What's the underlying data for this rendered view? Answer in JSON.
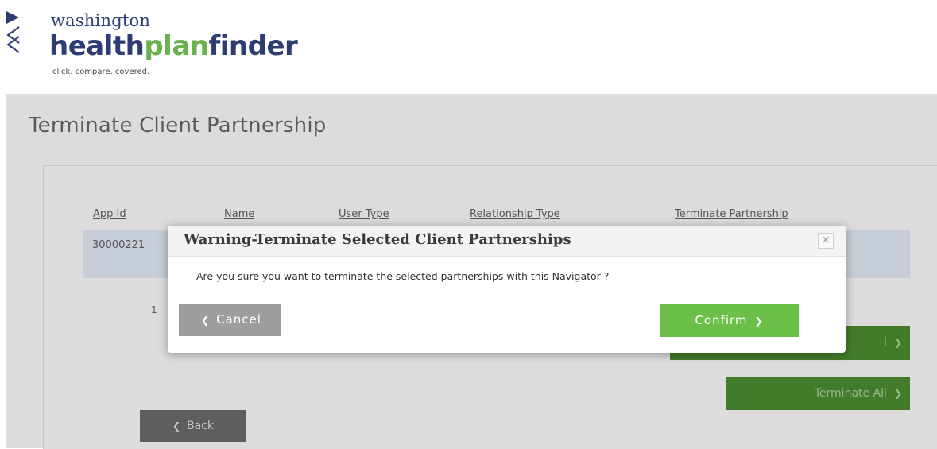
{
  "header": {
    "logo_word1": "washington",
    "logo_health": "health",
    "logo_plan": "plan",
    "logo_finder": "finder",
    "tagline": "click. compare. covered."
  },
  "page": {
    "title": "Terminate Client Partnership"
  },
  "table": {
    "columns": [
      "App Id",
      "Name",
      "User Type",
      "Relationship Type",
      "Terminate Partnership"
    ],
    "rows": [
      {
        "app_id": "30000221"
      }
    ]
  },
  "pagination": {
    "current_page": "1"
  },
  "buttons": {
    "terminate_selected_visible": "l",
    "terminate_all": "Terminate All",
    "back": "Back"
  },
  "modal": {
    "title": "Warning-Terminate Selected Client Partnerships",
    "message": "Are you sure you want to terminate the selected partnerships with this Navigator ?",
    "cancel_label": "Cancel",
    "confirm_label": "Confirm"
  },
  "colors": {
    "brand_navy": "#2d3d73",
    "brand_green": "#6ab04c",
    "confirm_green": "#6cc04a",
    "cancel_gray": "#9e9e9e"
  }
}
